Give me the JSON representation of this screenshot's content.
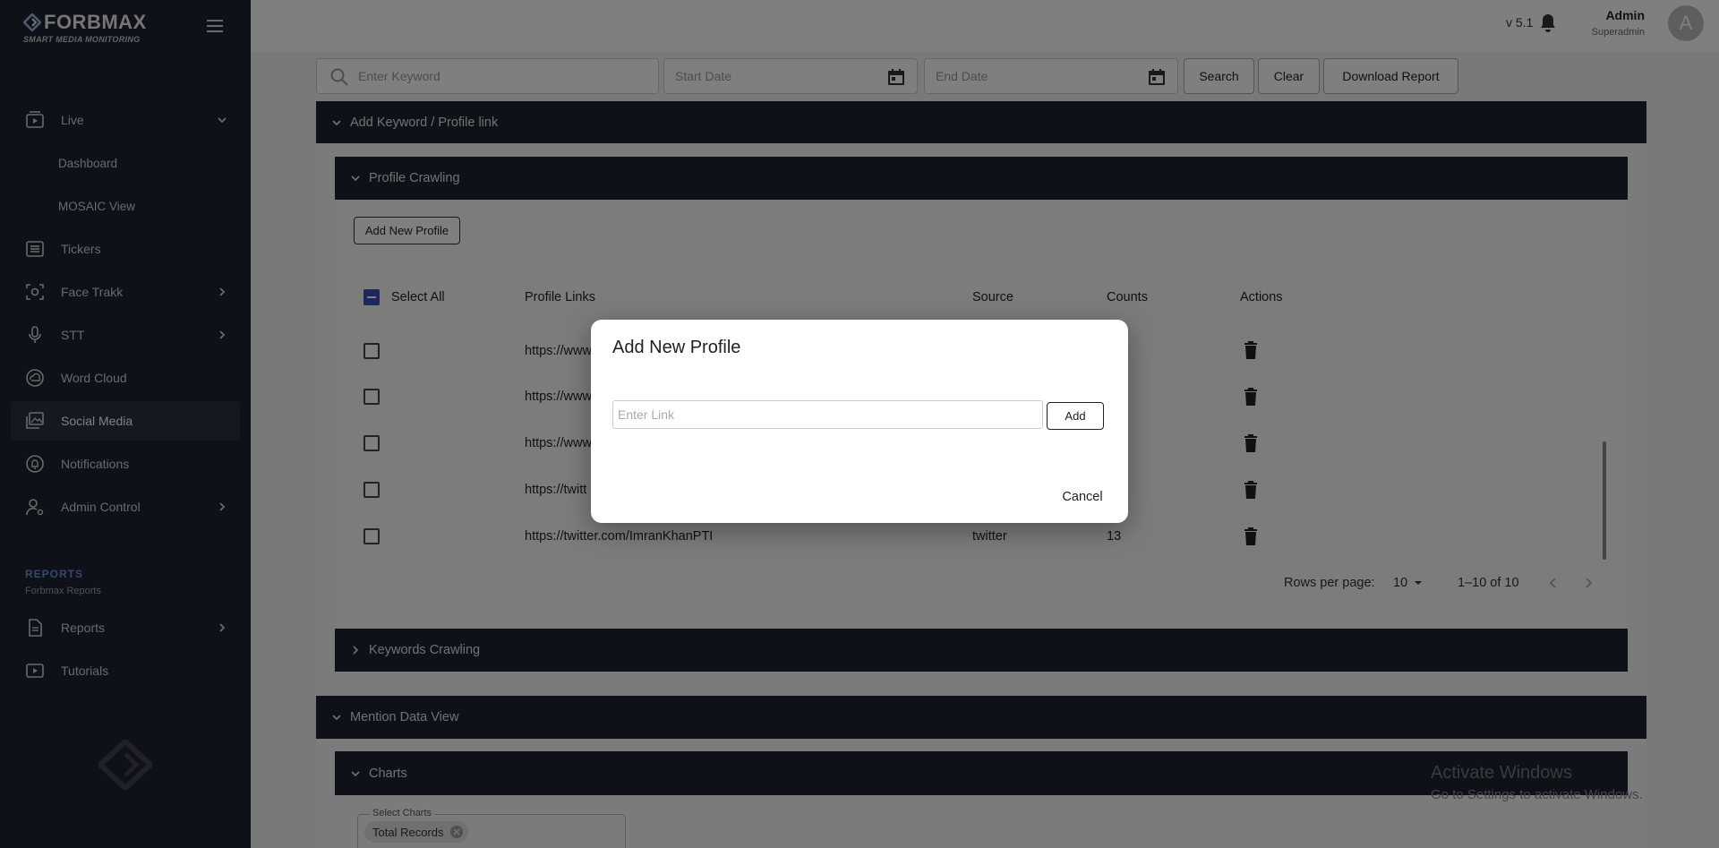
{
  "app": {
    "logo_text": "FORBMAX",
    "logo_subtitle": "SMART MEDIA MONITORING",
    "version": "v 5.1"
  },
  "user": {
    "name": "Admin",
    "role": "Superadmin",
    "initial": "A"
  },
  "sidebar": {
    "items": [
      {
        "label": "Live",
        "icon": "live-video-icon",
        "arrow": "chevron-down"
      },
      {
        "label": "Dashboard",
        "sub": true
      },
      {
        "label": "MOSAIC View",
        "sub": true
      },
      {
        "label": "Tickers",
        "icon": "list-icon"
      },
      {
        "label": "Face Trakk",
        "icon": "face-scan-icon",
        "arrow": "chevron-right"
      },
      {
        "label": "STT",
        "icon": "microphone-icon",
        "arrow": "chevron-right"
      },
      {
        "label": "Word Cloud",
        "icon": "cloud-icon"
      },
      {
        "label": "Social Media",
        "icon": "gallery-icon",
        "active": true
      },
      {
        "label": "Notifications",
        "icon": "notification-icon"
      },
      {
        "label": "Admin Control",
        "icon": "user-gear-icon",
        "arrow": "chevron-right"
      }
    ],
    "reports_heading": "REPORTS",
    "reports_sub": "Forbmax Reports",
    "report_items": [
      {
        "label": "Reports",
        "icon": "document-icon",
        "arrow": "chevron-right"
      },
      {
        "label": "Tutorials",
        "icon": "play-icon"
      }
    ]
  },
  "toolbar": {
    "keyword_placeholder": "Enter Keyword",
    "start_date_placeholder": "Start Date",
    "end_date_placeholder": "End Date",
    "search_label": "Search",
    "clear_label": "Clear",
    "download_label": "Download Report"
  },
  "panels": {
    "add_keyword": "Add Keyword / Profile link",
    "profile_crawling": "Profile Crawling",
    "keywords_crawling": "Keywords Crawling",
    "mention_data_view": "Mention Data View",
    "charts": "Charts"
  },
  "profile_table": {
    "add_new_profile_label": "Add New Profile",
    "select_all_label": "Select All",
    "columns": [
      "Profile Links",
      "Source",
      "Counts",
      "Actions"
    ],
    "rows": [
      {
        "link": "https://www",
        "source": "",
        "count": ""
      },
      {
        "link": "https://www",
        "source": "",
        "count": ""
      },
      {
        "link": "https://www",
        "source": "",
        "count": ""
      },
      {
        "link": "https://twitt",
        "source": "",
        "count": ""
      },
      {
        "link": "https://twitter.com/ImranKhanPTI",
        "source": "twitter",
        "count": "13"
      }
    ],
    "rows_per_page_label": "Rows per page:",
    "rows_per_page_value": "10",
    "range_label": "1–10 of 10"
  },
  "charts_section": {
    "select_label": "Select Charts",
    "chip_label": "Total Records"
  },
  "windows_notice": {
    "line1": "Activate Windows",
    "line2": "Go to Settings to activate Windows."
  },
  "modal": {
    "title": "Add New Profile",
    "input_placeholder": "Enter Link",
    "input_value": "",
    "add_label": "Add",
    "cancel_label": "Cancel"
  }
}
